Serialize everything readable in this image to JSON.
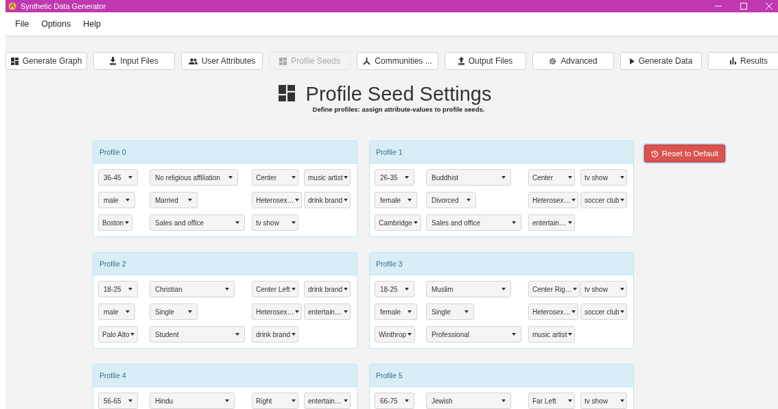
{
  "window": {
    "title": "Synthetic Data Generator"
  },
  "menu": [
    "File",
    "Options",
    "Help"
  ],
  "toolbar": [
    {
      "label": "Generate Graph",
      "disabled": false
    },
    {
      "label": "Input Files",
      "disabled": false
    },
    {
      "label": "User Attributes",
      "disabled": false
    },
    {
      "label": "Profile Seeds",
      "disabled": true
    },
    {
      "label": "Communities ...",
      "disabled": false
    },
    {
      "label": "Output Files",
      "disabled": false
    },
    {
      "label": "Advanced",
      "disabled": false
    },
    {
      "label": "Generate Data",
      "disabled": false
    },
    {
      "label": "Results",
      "disabled": false
    }
  ],
  "header": {
    "title": "Profile Seed Settings",
    "subtitle": "Define profiles: assign attribute-values to profile seeds."
  },
  "reset_button": "Reset to Default",
  "profiles": [
    {
      "title": "Profile 0",
      "rows": [
        [
          "36-45",
          "No religious affiliation",
          "Center",
          "music artist"
        ],
        [
          "male",
          "Married",
          "Heterosex…",
          "drink brand"
        ],
        [
          "Boston",
          "Sales and office",
          "tv show"
        ]
      ]
    },
    {
      "title": "Profile 1",
      "rows": [
        [
          "26-35",
          "Buddhist",
          "Center",
          "tv show"
        ],
        [
          "female",
          "Divorced",
          "Heterosex…",
          "soccer club"
        ],
        [
          "Cambridge",
          "Sales and office",
          "entertain…"
        ]
      ]
    },
    {
      "title": "Profile 2",
      "rows": [
        [
          "18-25",
          "Christian",
          "Center Left",
          "drink brand"
        ],
        [
          "male",
          "Single",
          "Heterosex…",
          "entertain…"
        ],
        [
          "Palo Alto",
          "Student",
          "drink brand"
        ]
      ]
    },
    {
      "title": "Profile 3",
      "rows": [
        [
          "18-25",
          "Muslim",
          "Center Rig…",
          "tv show"
        ],
        [
          "female",
          "Single",
          "Heterosex…",
          "soccer club"
        ],
        [
          "Winthrop",
          "Professional",
          "music artist"
        ]
      ]
    },
    {
      "title": "Profile 4",
      "rows": [
        [
          "56-65",
          "Hindu",
          "Right",
          "entertain…"
        ]
      ]
    },
    {
      "title": "Profile 5",
      "rows": [
        [
          "66-75",
          "Jewish",
          "Far Left",
          "tv show"
        ]
      ]
    }
  ]
}
